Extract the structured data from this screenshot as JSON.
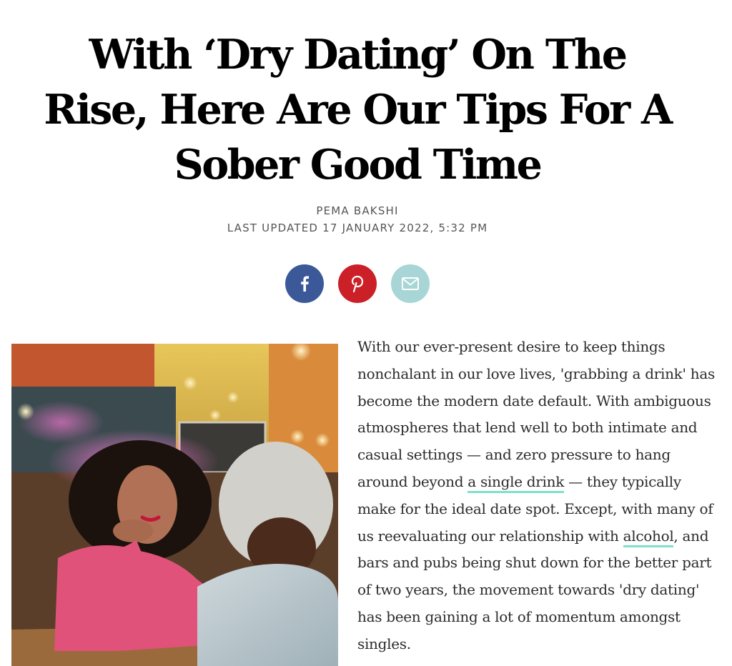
{
  "article": {
    "headline": "With ‘Dry Dating’ On The Rise, Here Are Our Tips For A Sober Good Time",
    "author": "PEMA BAKSHI",
    "last_updated": "LAST UPDATED 17 JANUARY 2022, 5:32 PM",
    "body": {
      "part1": "With our ever-present desire to keep things nonchalant in our love lives, 'grabbing a drink' has become the modern date default. With ambiguous atmospheres that lend well to both intimate and casual settings — and zero pressure to hang around beyond",
      "link1": "a single drink",
      "part2": " — they typically make for the ideal date spot. Except, with many of us reevaluating our relationship with ",
      "link2": "alcohol",
      "part3": ", and bars and pubs being shut down for the better part of two years, the movement towards 'dry dating' has been gaining a lot of momentum amongst singles."
    }
  },
  "share": [
    {
      "icon": "facebook-icon",
      "color": "#3b5998"
    },
    {
      "icon": "pinterest-icon",
      "color": "#cb2027"
    },
    {
      "icon": "email-icon",
      "color": "#a8d5d5"
    }
  ],
  "colors": {
    "link_underline": "#7ee0cc",
    "text": "#2b2b2b"
  }
}
